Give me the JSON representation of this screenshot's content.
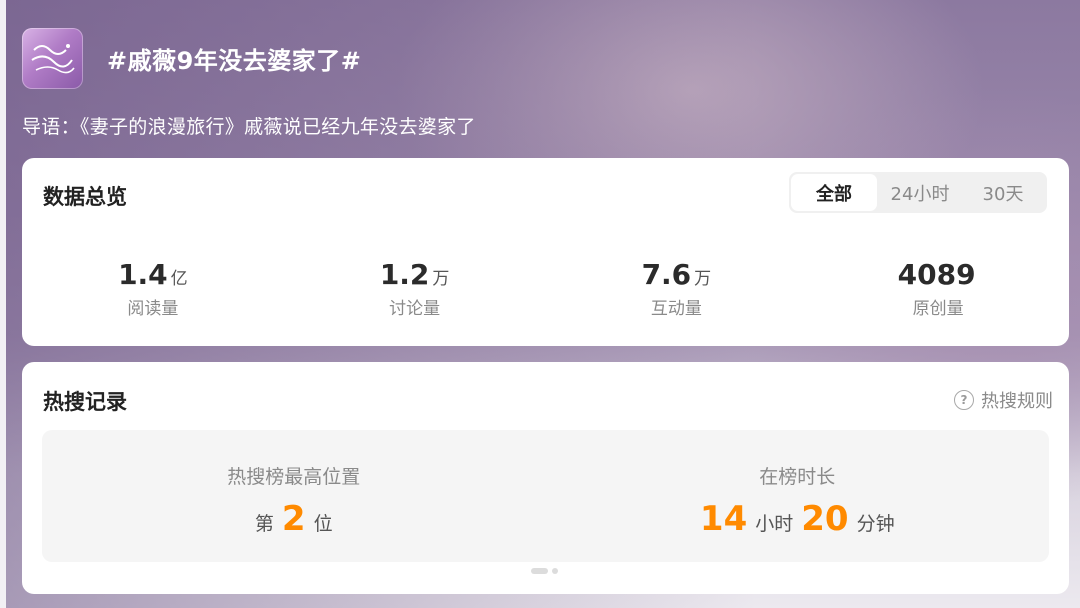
{
  "topic": {
    "title": "#戚薇9年没去婆家了#",
    "avatar_icon": "show-poster-icon",
    "intro": "导语：《妻子的浪漫旅行》戚薇说已经九年没去婆家了"
  },
  "overview": {
    "title": "数据总览",
    "tabs": [
      "全部",
      "24小时",
      "30天"
    ],
    "active_tab": "全部",
    "stats": [
      {
        "value": "1.4",
        "unit": "亿",
        "label": "阅读量"
      },
      {
        "value": "1.2",
        "unit": "万",
        "label": "讨论量"
      },
      {
        "value": "7.6",
        "unit": "万",
        "label": "互动量"
      },
      {
        "value": "4089",
        "unit": "",
        "label": "原创量"
      }
    ]
  },
  "hot_search": {
    "title": "热搜记录",
    "rules_label": "热搜规则",
    "rules_icon": "question-circle-icon",
    "highest_rank": {
      "label": "热搜榜最高位置",
      "prefix": "第",
      "value": "2",
      "suffix": "位"
    },
    "duration": {
      "label": "在榜时长",
      "hours": "14",
      "hours_unit": "小时",
      "minutes": "20",
      "minutes_unit": "分钟"
    }
  },
  "colors": {
    "accent": "#ff8a00",
    "card_bg": "#ffffff",
    "muted_text": "#8a8a8a"
  }
}
